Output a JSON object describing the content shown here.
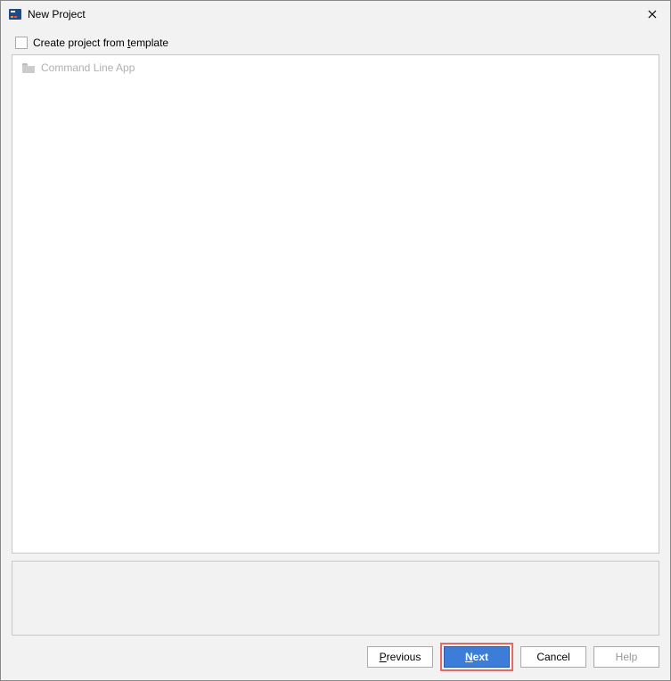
{
  "window": {
    "title": "New Project"
  },
  "checkbox": {
    "label_pre": "Create project from ",
    "label_mnemonic": "t",
    "label_post": "emplate",
    "checked": false
  },
  "templates": [
    {
      "label": "Command Line App"
    }
  ],
  "buttons": {
    "previous_mnemonic": "P",
    "previous_post": "revious",
    "next_mnemonic": "N",
    "next_post": "ext",
    "cancel": "Cancel",
    "help": "Help"
  }
}
